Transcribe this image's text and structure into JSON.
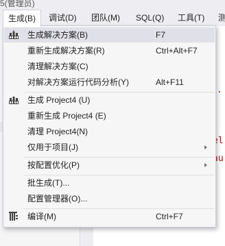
{
  "window": {
    "title_fragment": "5(管理员)"
  },
  "menubar": {
    "items": [
      {
        "label": "生成(B)",
        "active": true
      },
      {
        "label": "调试(D)"
      },
      {
        "label": "团队(M)"
      },
      {
        "label": "SQL(Q)"
      },
      {
        "label": "工具(T)"
      },
      {
        "label": "测"
      }
    ]
  },
  "editor": {
    "code_fragments": [
      "o.",
      "el",
      "au"
    ]
  },
  "build_menu": {
    "items": [
      {
        "label": "生成解决方案(B)",
        "shortcut": "F7",
        "icon": "build-solution-icon"
      },
      {
        "label": "重新生成解决方案(R)",
        "shortcut": "Ctrl+Alt+F7"
      },
      {
        "label": "清理解决方案(C)",
        "shortcut": ""
      },
      {
        "label": "对解决方案运行代码分析(Y)",
        "shortcut": "Alt+F11"
      },
      {
        "label": "生成 Project4 (U)",
        "shortcut": "",
        "icon": "build-project-icon"
      },
      {
        "label": "重新生成 Project4 (E)",
        "shortcut": ""
      },
      {
        "label": "清理 Project4(N)",
        "shortcut": ""
      },
      {
        "label": "仅用于项目(J)",
        "shortcut": "",
        "submenu": true
      },
      {
        "label": "按配置优化(P)",
        "shortcut": "",
        "submenu": true
      },
      {
        "label": "批生成(T)...",
        "shortcut": ""
      },
      {
        "label": "配置管理器(O)...",
        "shortcut": ""
      },
      {
        "label": "编译(M)",
        "shortcut": "Ctrl+F7",
        "icon": "compile-icon"
      }
    ]
  },
  "colors": {
    "menu_background": "#f6f6f6",
    "hover_background": "#e0e0e8",
    "code_text": "#a31515",
    "icon_dark": "#424242"
  }
}
